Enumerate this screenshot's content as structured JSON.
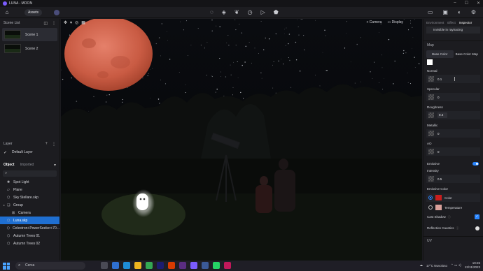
{
  "app": {
    "title": "LUNA - MOON"
  },
  "toolbar": {
    "assets_label": "Assets"
  },
  "viewport": {
    "camera_label": "Camera",
    "display_label": "Display"
  },
  "left_panel": {
    "scene_list_title": "Scene List",
    "scenes": [
      {
        "label": "Scene 1"
      },
      {
        "label": "Scene 2"
      }
    ],
    "layer_title": "Layer",
    "layers": [
      {
        "label": "Default Layer"
      }
    ],
    "tabs": {
      "object": "Object",
      "imported": "Imported"
    },
    "objects": [
      {
        "label": "Spot Light",
        "icon": "light-icon"
      },
      {
        "label": "Plane",
        "icon": "plane-icon"
      },
      {
        "label": "Sky Stellare.skp",
        "icon": "model-icon"
      },
      {
        "label": "Group",
        "icon": "group-icon"
      },
      {
        "label": "Camera",
        "icon": "camera-icon"
      },
      {
        "label": "Luna.skp",
        "icon": "model-icon"
      },
      {
        "label": "Celestron+PowerSeeker+70...",
        "icon": "model-icon"
      },
      {
        "label": "Autumn Trees 01",
        "icon": "model-icon"
      },
      {
        "label": "Autumn Trees 02",
        "icon": "model-icon"
      }
    ]
  },
  "right_panel": {
    "tabs": {
      "environment": "Environment",
      "effect": "Effect",
      "inspector": "Inspector"
    },
    "invisible_label": "Invisible in raytracing",
    "map_title": "Map",
    "map_tabs": {
      "base_color": "Base Color",
      "base_color_map": "Base Color Map"
    },
    "normal_label": "Normal",
    "normal_value": "0.1",
    "specular_label": "Specular",
    "specular_value": "0",
    "roughness_label": "Roughness",
    "roughness_value": "0.4",
    "metallic_label": "Metallic",
    "metallic_value": "0",
    "ao_label": "AO",
    "ao_value": "0",
    "emissive_label": "Emissive",
    "intensity_label": "Intensity",
    "intensity_value": "0.5",
    "emissive_color_label": "Emissive Color",
    "color_option": "Color",
    "temperature_option": "Temperature",
    "cast_shadow_label": "Cast Shadow",
    "reflection_caustics_label": "Reflection Caustics",
    "uv_label": "UV",
    "colors": {
      "emissive": "#c81e1e",
      "temperature": "#d9a09a",
      "accent": "#2a86ff"
    }
  },
  "taskbar": {
    "search_placeholder": "Cerca",
    "weather": "17°C  Nuvoloso",
    "time": "19:26",
    "date": "13/11/2023"
  }
}
